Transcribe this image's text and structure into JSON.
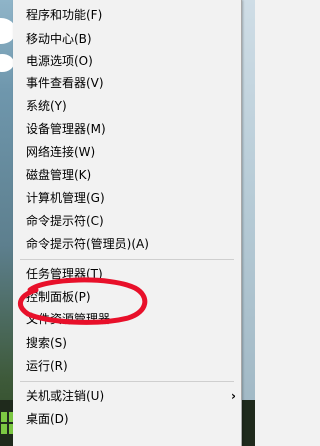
{
  "menu": {
    "items": [
      {
        "label": "程序和功能(F)"
      },
      {
        "label": "移动中心(B)"
      },
      {
        "label": "电源选项(O)"
      },
      {
        "label": "事件查看器(V)"
      },
      {
        "label": "系统(Y)"
      },
      {
        "label": "设备管理器(M)"
      },
      {
        "label": "网络连接(W)"
      },
      {
        "label": "磁盘管理(K)"
      },
      {
        "label": "计算机管理(G)"
      },
      {
        "label": "命令提示符(C)"
      },
      {
        "label": "命令提示符(管理员)(A)"
      },
      {
        "label": "任务管理器(T)"
      },
      {
        "label": "控制面板(P)"
      },
      {
        "label": "文件资源管理器"
      },
      {
        "label": "搜索(S)"
      },
      {
        "label": "运行(R)"
      },
      {
        "label": "关机或注销(U)"
      },
      {
        "label": "桌面(D)"
      }
    ]
  },
  "colors": {
    "annotation": "#e8102a",
    "menu_bg": "#f2f2f2"
  },
  "icons": {
    "submenu": "chevron-right-icon"
  }
}
